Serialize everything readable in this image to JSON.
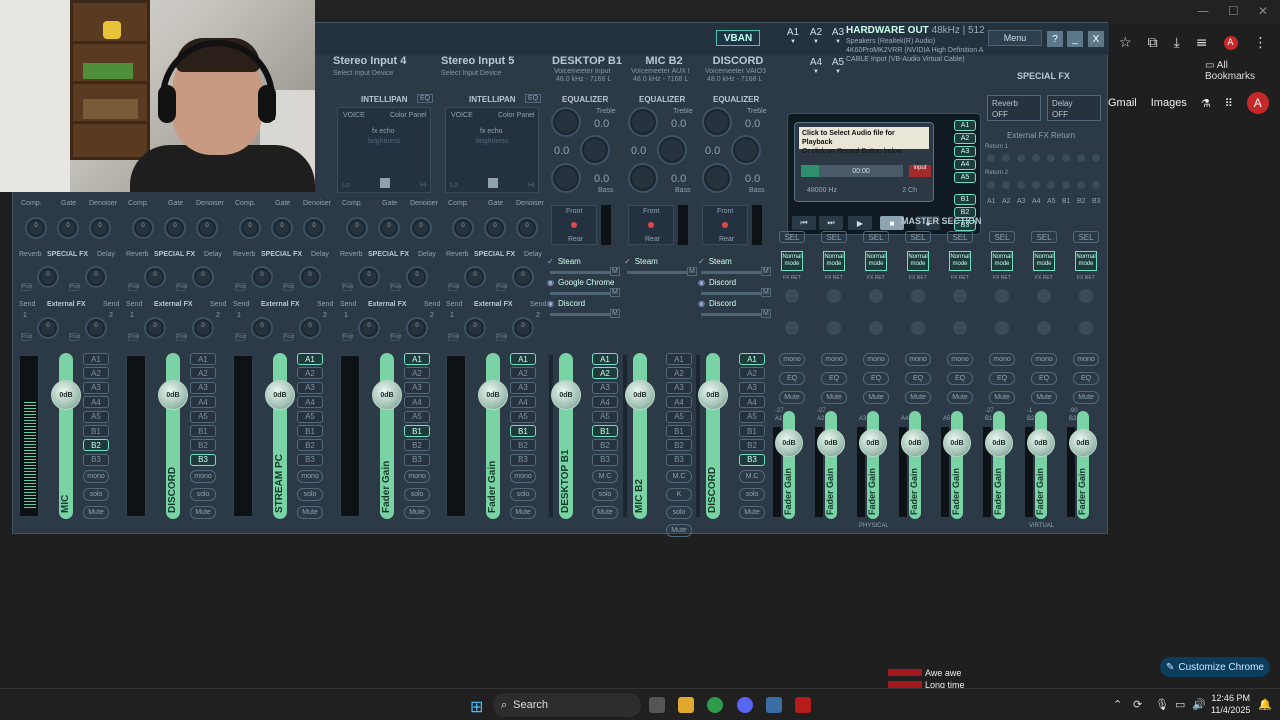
{
  "chrome": {
    "win_controls": [
      "—",
      "☐",
      "✕"
    ],
    "bookmarks_label": "All Bookmarks",
    "links": [
      "Gmail",
      "Images"
    ],
    "avatar": "A",
    "customize_label": "Customize Chrome"
  },
  "voicemeeter": {
    "vban": "VBAN",
    "hw_out_title": "HARDWARE OUT",
    "hw_out_rate": "48kHz | 512",
    "hw_out_lines": [
      "Speakers (Realtek(R) Audio)",
      "4K60ProMK2VRR (NVIDIA High Definition A",
      "CABLE Input (VB-Audio Virtual Cable)"
    ],
    "menu": "Menu",
    "help": "?",
    "minimize": "_",
    "close": "X",
    "bus_top": [
      "A1",
      "A2",
      "A3",
      "A4",
      "A5"
    ],
    "inputs": [
      {
        "title": "Stereo Input 4",
        "sub": "Select Input Device",
        "intellipan": "INTELLIPAN",
        "eq": "EQ",
        "voice": "VOICE",
        "color_panel": "Color Panel",
        "fx": "fx echo",
        "bright": "brightness",
        "lo": "Lo",
        "hi": "Hi"
      },
      {
        "title": "Stereo Input 5",
        "sub": "Select Input Device",
        "intellipan": "INTELLIPAN",
        "eq": "EQ",
        "voice": "VOICE",
        "color_panel": "Color Panel",
        "fx": "fx echo",
        "bright": "brightness",
        "lo": "Lo",
        "hi": "Hi"
      }
    ],
    "virtual": [
      {
        "title": "DESKTOP B1",
        "sub": "Voicemeeter Input",
        "rate": "48.0 kHz - 7168 L",
        "apps": [
          "Steam",
          "Google Chrome",
          "Discord"
        ]
      },
      {
        "title": "MIC B2",
        "sub": "Voicemeeter AUX I",
        "rate": "48.0 kHz - 7168 L",
        "apps": [
          "Steam"
        ]
      },
      {
        "title": "DISCORD",
        "sub": "Voicemeeter VAIO3",
        "rate": "48.0 kHz - 7168 L",
        "apps": [
          "Steam",
          "Discord",
          "Discord"
        ]
      }
    ],
    "eq_labels": {
      "equalizer": "EQUALIZER",
      "treble": "Treble",
      "bass": "Bass",
      "zero": "0.0",
      "front": "Front",
      "rear": "Rear"
    },
    "row_labels": {
      "comp": "Comp.",
      "gate": "Gate",
      "denoiser": "Denoiser",
      "reverb": "Reverb",
      "special_fx": "SPECIAL FX",
      "delay": "Delay",
      "send": "Send",
      "external_fx": "External FX",
      "one": "1",
      "two": "2",
      "zero": "0",
      "post": "Post"
    },
    "strips": [
      {
        "name": "MIC",
        "buses_on": [
          "B2"
        ]
      },
      {
        "name": "DISCORD",
        "buses_on": [
          "B3"
        ]
      },
      {
        "name": "STREAM PC",
        "buses_on": [
          "A1"
        ]
      },
      {
        "name": "Fader Gain",
        "buses_on": [
          "A1",
          "B1"
        ]
      },
      {
        "name": "Fader Gain",
        "buses_on": [
          "A1",
          "B1"
        ]
      },
      {
        "name": "DESKTOP B1",
        "buses_on": [
          "A1",
          "A2",
          "B1"
        ]
      },
      {
        "name": "MIC B2",
        "buses_on": []
      },
      {
        "name": "DISCORD",
        "buses_on": [
          "A1",
          "B3"
        ]
      }
    ],
    "bus_labels": [
      "A1",
      "A2",
      "A3",
      "A4",
      "A5",
      "B1",
      "B2",
      "B3"
    ],
    "fader_value": "0dB",
    "strip_buttons": {
      "mono": "mono",
      "solo": "solo",
      "mute": "Mute",
      "mc": "M.C",
      "k": "K"
    },
    "special_fx": {
      "title": "SPECIAL FX",
      "reverb": "Reverb",
      "delay": "Delay",
      "off": "OFF",
      "ext_return": "External FX Return",
      "return1": "Return 1",
      "return2": "Return 2",
      "bus_row": [
        "A1",
        "A2",
        "A3",
        "A4",
        "A5",
        "B1",
        "B2",
        "B3"
      ]
    },
    "player": {
      "card_line1": "Click to Select Audio file for Playback",
      "card_line2": "Or click on Record Button below",
      "time": "00:00",
      "input": "input",
      "freq": "48000 Hz",
      "channels": "2 Ch",
      "controls": [
        "⏮",
        "⏭",
        "▶",
        "■",
        "●"
      ],
      "bus_buttons": [
        "A1",
        "A2",
        "A3",
        "A4",
        "A5",
        "B1",
        "B2",
        "B3"
      ]
    },
    "master": {
      "title": "MASTER SECTION",
      "sel": "SEL",
      "normal_mode": "Normal mode",
      "fx_ret": "FX RET",
      "mono": "mono",
      "eq": "EQ",
      "mute": "Mute",
      "fader": "Fader Gain",
      "fader_value": "0dB",
      "bus_names": [
        "A1",
        "A2",
        "A3",
        "A4",
        "A5",
        "B1",
        "B2",
        "B3"
      ],
      "db_values": [
        "-27",
        "-27",
        "",
        "",
        "",
        "-27",
        "-1",
        "-90"
      ],
      "physical": "PHYSICAL",
      "virtual": "VIRTUAL"
    }
  },
  "chat": [
    {
      "msg": "Awe awe"
    },
    {
      "msg": "Long time"
    }
  ],
  "taskbar": {
    "search": "Search",
    "time": "12:46 PM",
    "date": "11/4/2025"
  }
}
